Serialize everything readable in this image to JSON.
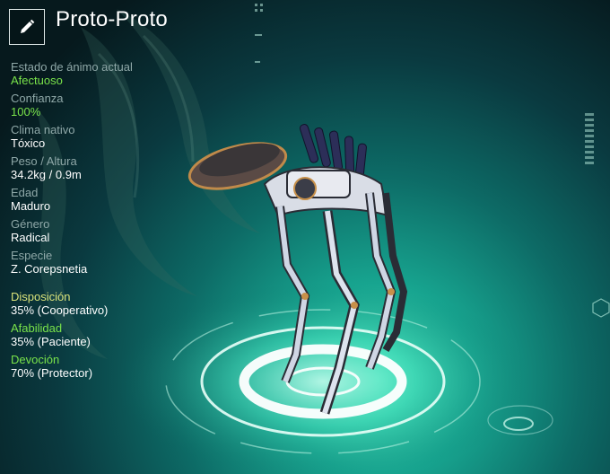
{
  "creature": {
    "name": "Proto-Proto"
  },
  "stats": [
    {
      "label": "Estado de ánimo actual",
      "value": "Afectuoso",
      "value_color": "green"
    },
    {
      "label": "Confianza",
      "value": "100%",
      "value_color": "green"
    },
    {
      "label": "Clima nativo",
      "value": "Tóxico"
    },
    {
      "label": "Peso / Altura",
      "value": "34.2kg / 0.9m"
    },
    {
      "label": "Edad",
      "value": "Maduro"
    },
    {
      "label": "Género",
      "value": "Radical"
    },
    {
      "label": "Especie",
      "value": "Z. Corepsnetia"
    }
  ],
  "traits": [
    {
      "label": "Disposición",
      "value": "35% (Cooperativo)",
      "label_color": "yellow"
    },
    {
      "label": "Afabilidad",
      "value": "35% (Paciente)",
      "label_color": "green"
    },
    {
      "label": "Devoción",
      "value": "70% (Protector)",
      "label_color": "green"
    }
  ],
  "icons": {
    "edit": "pencil-icon"
  },
  "colors": {
    "accent_green": "#79e34a",
    "accent_yellow": "#d9e27a",
    "label_gray": "#8fa8a8"
  }
}
